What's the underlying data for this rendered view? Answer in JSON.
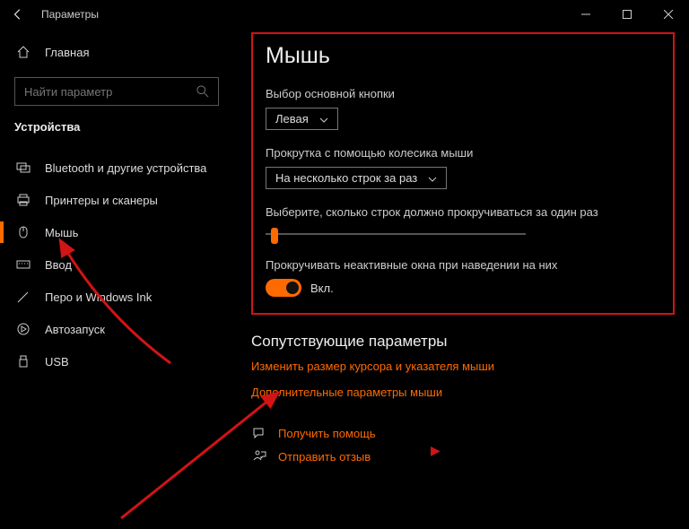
{
  "window": {
    "title": "Параметры"
  },
  "sidebar": {
    "home": "Главная",
    "search_placeholder": "Найти параметр",
    "category": "Устройства",
    "items": [
      {
        "label": "Bluetooth и другие устройства"
      },
      {
        "label": "Принтеры и сканеры"
      },
      {
        "label": "Мышь"
      },
      {
        "label": "Ввод"
      },
      {
        "label": "Перо и Windows Ink"
      },
      {
        "label": "Автозапуск"
      },
      {
        "label": "USB"
      }
    ]
  },
  "content": {
    "heading": "Мышь",
    "primary_button_label": "Выбор основной кнопки",
    "primary_button_value": "Левая",
    "scroll_label": "Прокрутка с помощью колесика мыши",
    "scroll_value": "На несколько строк за раз",
    "lines_label": "Выберите, сколько строк должно прокручиваться за один раз",
    "inactive_label": "Прокручивать неактивные окна при наведении на них",
    "toggle_value": "Вкл.",
    "related_heading": "Сопутствующие параметры",
    "link_cursor": "Изменить размер курсора и указателя мыши",
    "link_additional": "Дополнительные параметры мыши",
    "help": "Получить помощь",
    "feedback": "Отправить отзыв"
  }
}
